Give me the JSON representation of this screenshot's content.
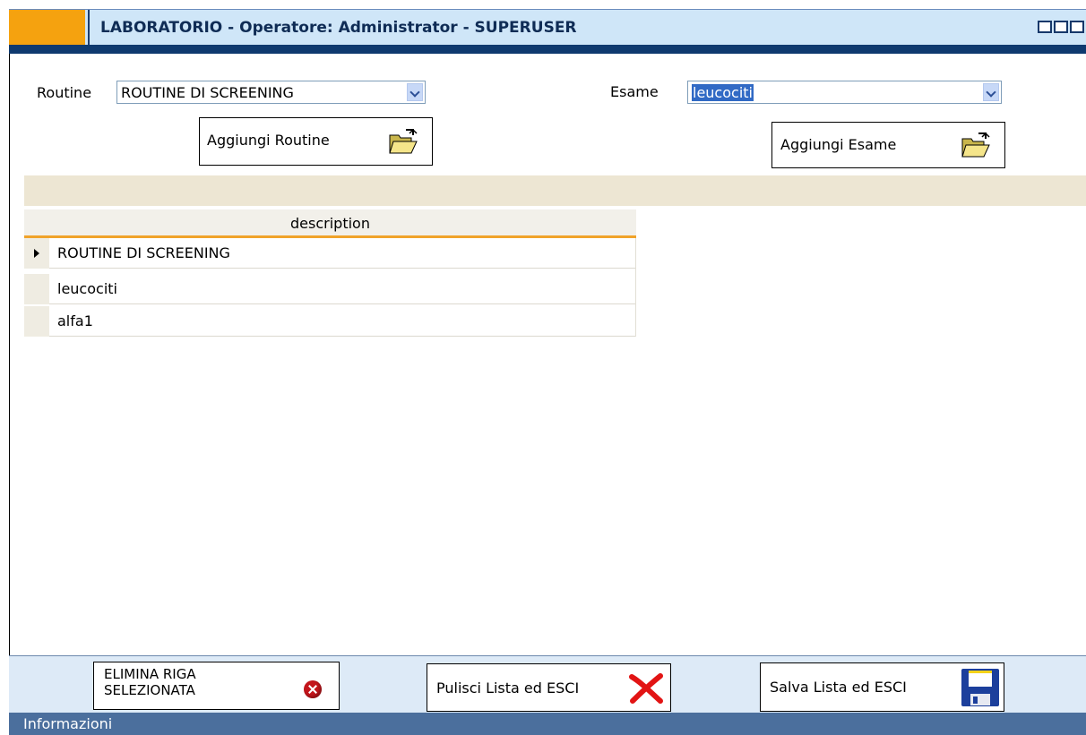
{
  "window": {
    "title": "LABORATORIO - Operatore: Administrator -  SUPERUSER"
  },
  "form": {
    "routine_label": "Routine",
    "routine_value": "ROUTINE DI SCREENING",
    "esame_label": "Esame",
    "esame_value": "leucociti",
    "add_routine_label": "Aggiungi Routine",
    "add_esame_label": "Aggiungi Esame"
  },
  "grid": {
    "column_header": "description",
    "rows": [
      {
        "description": "ROUTINE DI SCREENING",
        "selected": true
      },
      {
        "description": "leucociti",
        "selected": false
      },
      {
        "description": "alfa1",
        "selected": false
      }
    ]
  },
  "footer": {
    "delete_row_label_line1": "ELIMINA RIGA",
    "delete_row_label_line2": "SELEZIONATA",
    "clear_exit_label": "Pulisci Lista ed ESCI",
    "save_exit_label": "Salva Lista ed ESCI",
    "status_text": "Informazioni"
  },
  "colors": {
    "accent_orange": "#f5a20f",
    "title_bar": "#cfe6f8",
    "status_bar": "#4b6f9d"
  }
}
